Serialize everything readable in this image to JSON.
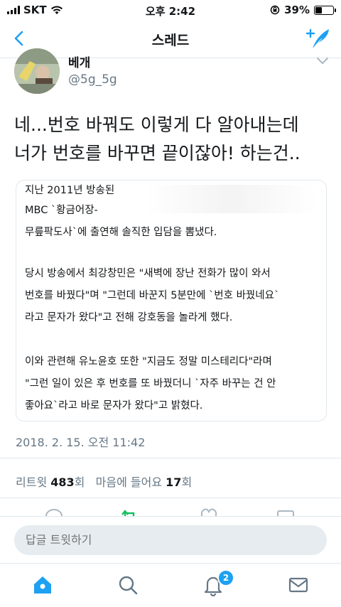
{
  "status_bar": {
    "carrier": "SKT",
    "time": "오후 2:42",
    "battery_percent": "39%",
    "battery_level": 0.39
  },
  "nav": {
    "title": "스레드"
  },
  "author": {
    "name": "베개",
    "handle": "@5g_5g"
  },
  "tweet": {
    "lines": [
      "네...번호 바꿔도 이렇게 다 알아내는데",
      "너가 번호를 바꾸면 끝이잖아! 하는건.."
    ],
    "card_lines": [
      "지난 2011년 방송된",
      "MBC `황금어장-",
      "무릎팍도사`에 출연해 솔직한 입담을 뽐냈다.",
      "",
      "당시 방송에서 최강창민은 \"새벽에 장난 전화가 많이 와서",
      "번호를 바꿨다\"며 \"그런데 바꾼지 5분만에 `번호 바꿨네요`",
      "라고 문자가 왔다\"고 전해 강호동을 놀라게 했다.",
      "",
      "이와 관련해 유노윤호 또한 \"지금도 정말 미스테리다\"라며",
      "\"그런 일이 있은 후 번호를 또 바꿨더니 `자주 바꾸는 건 안",
      "좋아요`라고 바로 문자가 왔다\"고 밝혔다."
    ],
    "timestamp": "2018. 2. 15. 오전 11:42",
    "retweet_label": "리트윗",
    "retweet_count": "483",
    "retweet_unit": "회",
    "like_label": "마음에 들어요",
    "like_count": "17",
    "like_unit": "회"
  },
  "reply": {
    "placeholder": "답글 트윗하기"
  },
  "tabs": {
    "notification_badge": "2"
  },
  "colors": {
    "accent": "#1da1f2",
    "secondary_text": "#657786",
    "divider": "#e1e8ed"
  }
}
